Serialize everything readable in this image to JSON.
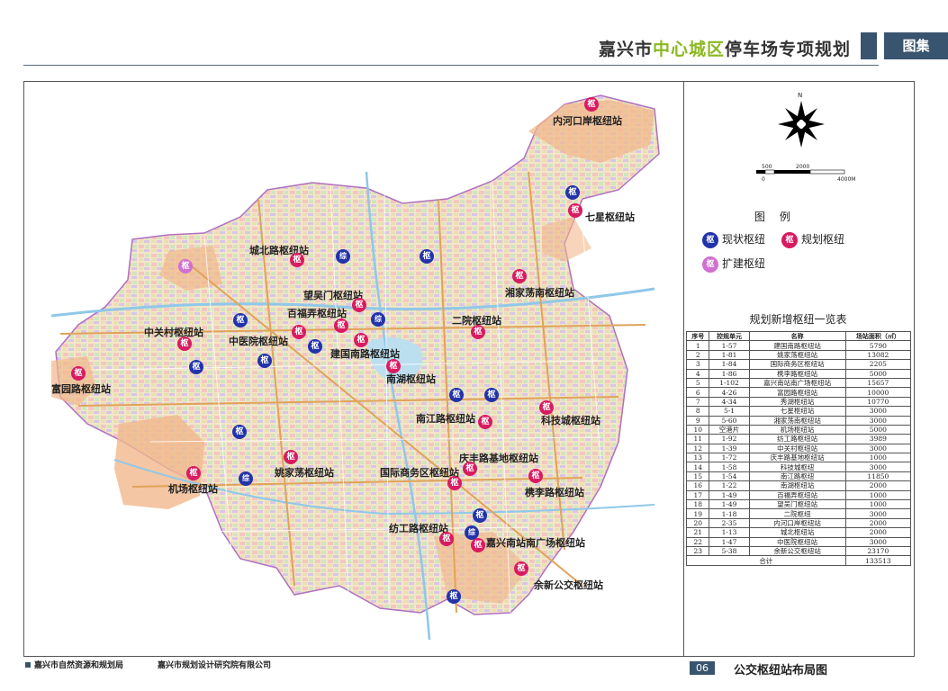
{
  "header": {
    "title_prefix": "嘉兴市",
    "title_highlight": "中心城区",
    "title_suffix": "停车场专项规划",
    "atlas_label": "图集"
  },
  "compass": {
    "north": "N"
  },
  "scale": {
    "labels": [
      "500",
      "0",
      "2000",
      "4000M"
    ]
  },
  "legend": {
    "title": "图 例",
    "items": [
      {
        "glyph": "枢",
        "label": "现状枢纽",
        "kind": "existing"
      },
      {
        "glyph": "枢",
        "label": "规划枢纽",
        "kind": "planned"
      },
      {
        "glyph": "枢",
        "label": "扩建枢纽",
        "kind": "expand"
      }
    ]
  },
  "table": {
    "title": "规划新增枢纽一览表",
    "headers": [
      "序号",
      "控规单元",
      "名称",
      "场站面积（㎡）"
    ],
    "rows": [
      [
        "1",
        "1-57",
        "建国南路枢纽站",
        "5790"
      ],
      [
        "2",
        "1-81",
        "姚家荡枢纽站",
        "13082"
      ],
      [
        "3",
        "1-84",
        "国际商务区枢纽站",
        "2205"
      ],
      [
        "4",
        "1-86",
        "槜李路枢纽站",
        "5000"
      ],
      [
        "5",
        "1-102",
        "嘉兴南站南广场枢纽站",
        "15657"
      ],
      [
        "6",
        "4-26",
        "富园路枢纽站",
        "10000"
      ],
      [
        "7",
        "4-34",
        "秀湖枢纽站",
        "10770"
      ],
      [
        "8",
        "5-1",
        "七星枢纽站",
        "3000"
      ],
      [
        "9",
        "5-60",
        "湘家荡南枢纽站",
        "3000"
      ],
      [
        "10",
        "空港片",
        "机场枢纽站",
        "5000"
      ],
      [
        "11",
        "1-92",
        "纺工路枢纽站",
        "3989"
      ],
      [
        "12",
        "1-39",
        "中关村枢纽站",
        "3000"
      ],
      [
        "13",
        "1-72",
        "庆丰路基地枢纽站",
        "1000"
      ],
      [
        "14",
        "1-58",
        "科技城枢纽",
        "3000"
      ],
      [
        "15",
        "1-54",
        "南江路枢纽",
        "11850"
      ],
      [
        "16",
        "1-22",
        "南湖枢纽站",
        "2000"
      ],
      [
        "17",
        "1-49",
        "百福弄枢纽站",
        "1000"
      ],
      [
        "18",
        "1-49",
        "望吴门枢纽站",
        "1000"
      ],
      [
        "19",
        "1-18",
        "二院枢纽",
        "3000"
      ],
      [
        "20",
        "2-35",
        "内河口岸枢纽站",
        "2000"
      ],
      [
        "21",
        "1-13",
        "城北枢纽站",
        "2000"
      ],
      [
        "22",
        "1-47",
        "中医院枢纽站",
        "3000"
      ],
      [
        "23",
        "5-38",
        "余新公交枢纽站",
        "23170"
      ]
    ],
    "total_label": "合计",
    "total_value": "133513"
  },
  "map": {
    "stations": [
      {
        "label": "内河口岸枢纽站"
      },
      {
        "label": "七星枢纽站"
      },
      {
        "label": "城北路枢纽站"
      },
      {
        "label": "望吴门枢纽站"
      },
      {
        "label": "百福弄枢纽站"
      },
      {
        "label": "湘家荡南枢纽站"
      },
      {
        "label": "二院枢纽站"
      },
      {
        "label": "中关村枢纽站"
      },
      {
        "label": "中医院枢纽站"
      },
      {
        "label": "建国南路枢纽站"
      },
      {
        "label": "南湖枢纽站"
      },
      {
        "label": "富园路枢纽站"
      },
      {
        "label": "南江路枢纽站"
      },
      {
        "label": "科技城枢纽站"
      },
      {
        "label": "庆丰路基地枢纽站"
      },
      {
        "label": "国际商务区枢纽站"
      },
      {
        "label": "姚家荡枢纽站"
      },
      {
        "label": "槜李路枢纽站"
      },
      {
        "label": "机场枢纽站"
      },
      {
        "label": "纺工路枢纽站"
      },
      {
        "label": "嘉兴南站南广场枢纽站"
      },
      {
        "label": "余新公交枢纽站"
      }
    ],
    "glyph_hub": "枢",
    "glyph_combo": "综"
  },
  "footer": {
    "left1": "嘉兴市自然资源和规划局",
    "left2": "嘉兴市规划设计研究院有限公司",
    "page_number": "06",
    "caption": "公交枢纽站布局图"
  }
}
